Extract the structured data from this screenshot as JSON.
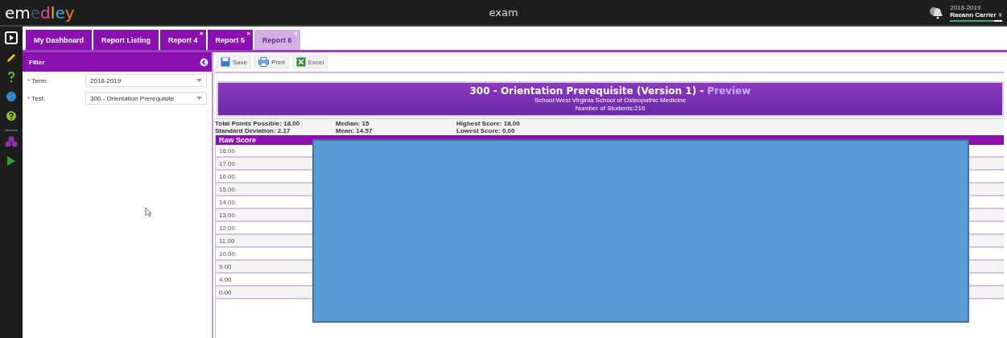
{
  "app": {
    "logo": "emedley",
    "title": "exam",
    "term": "2018-2019",
    "user": "Raeann Carrier",
    "user_caret": "¥",
    "progress": {
      "level": 0.85
    }
  },
  "tabs": [
    {
      "label": "My Dashboard",
      "selected": false
    },
    {
      "label": "Report Listing",
      "selected": false
    },
    {
      "label": "Report 4",
      "close": "×",
      "selected": false
    },
    {
      "label": "Report 5",
      "close": "×",
      "selected": false
    },
    {
      "label": "Report 6",
      "close": "×",
      "selected": true
    }
  ],
  "filter": {
    "title": "Filter",
    "fields": [
      {
        "label": "Term:",
        "value": "2018-2019",
        "required_mark": "*"
      },
      {
        "label": "Test:",
        "value": "300 - Orientation Prerequisite",
        "required_mark": "*"
      }
    ]
  },
  "toolbar": [
    {
      "label": "Save",
      "kind": "save"
    },
    {
      "label": "Print",
      "kind": "print"
    },
    {
      "label": "Excel",
      "kind": "excel"
    }
  ],
  "report": {
    "title": "300 - Orientation Prerequisite (Version 1) - ",
    "title_suffix": "Preview",
    "school": "School:West Virginia School of Osteopathic Medicine",
    "students": "Number of Students:216",
    "stats": [
      [
        "Total Points Possible: 18.00",
        "Standard Deviation: 2.17"
      ],
      [
        "Median: 15",
        "Mean: 14.57"
      ],
      [
        "Highest Score: 18.00",
        "Lowest Score: 0.00"
      ]
    ],
    "columns": [
      "Raw Score"
    ],
    "rows": [
      "18.00",
      "17.00",
      "16.00",
      "15.00",
      "14.00",
      "13.00",
      "12.00",
      "11.00",
      "10.00",
      "9.00",
      "4.00",
      "0.00"
    ]
  }
}
